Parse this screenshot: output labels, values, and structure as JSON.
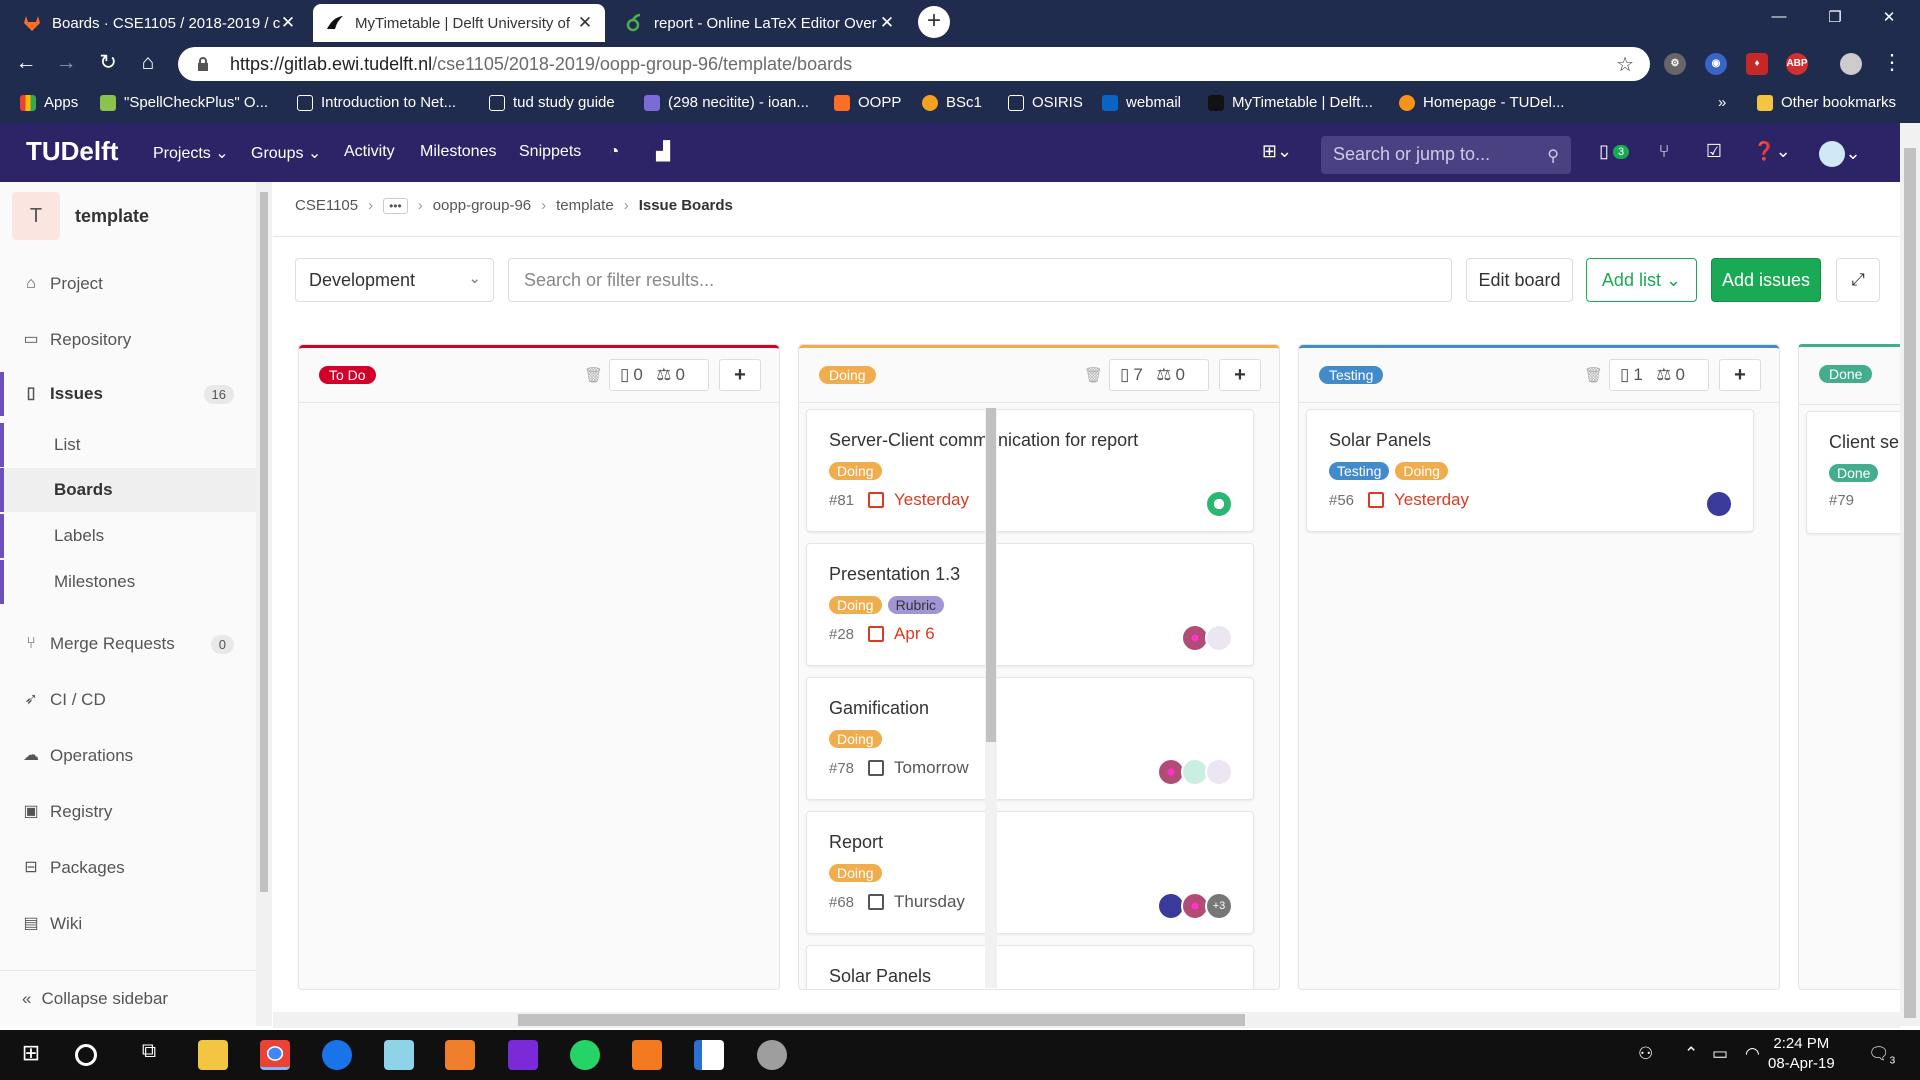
{
  "browser": {
    "tabs": [
      {
        "title": "Boards · CSE1105 / 2018-2019 / c",
        "active": false
      },
      {
        "title": "MyTimetable | Delft University of",
        "active": true
      },
      {
        "title": "report - Online LaTeX Editor Over",
        "active": false
      }
    ],
    "url_host": "https://gitlab.ewi.tudelft.nl",
    "url_path": "/cse1105/2018-2019/oopp-group-96/template/boards",
    "extensions": [
      "settings",
      "owl",
      "shield",
      "ABP"
    ],
    "bookmarks": [
      {
        "label": "Apps",
        "icon": "apps-grid-icon"
      },
      {
        "label": "\"SpellCheckPlus\" O...",
        "icon": "check-leaf-icon"
      },
      {
        "label": "Introduction to Net...",
        "icon": "page-icon"
      },
      {
        "label": "tud study guide",
        "icon": "page-icon"
      },
      {
        "label": "(298 necitite) - ioan...",
        "icon": "mail-icon"
      },
      {
        "label": "OOPP",
        "icon": "gitlab-icon"
      },
      {
        "label": "BSc1",
        "icon": "dots-icon"
      },
      {
        "label": "OSIRIS",
        "icon": "page-icon"
      },
      {
        "label": "webmail",
        "icon": "outlook-icon"
      },
      {
        "label": "MyTimetable | Delft...",
        "icon": "bird-icon"
      },
      {
        "label": "Homepage - TUDel...",
        "icon": "b-icon"
      }
    ],
    "bookmarks_overflow": "»",
    "other_bookmarks": "Other bookmarks"
  },
  "gitlab": {
    "logo": "TUDelft",
    "nav": [
      "Projects",
      "Groups",
      "Activity",
      "Milestones",
      "Snippets"
    ],
    "search_placeholder": "Search or jump to...",
    "todo_count": "3"
  },
  "sidebar": {
    "avatar_letter": "T",
    "project_name": "template",
    "items": [
      {
        "label": "Project",
        "icon": "home-icon"
      },
      {
        "label": "Repository",
        "icon": "book-icon"
      },
      {
        "label": "Issues",
        "icon": "issues-icon",
        "badge": "16"
      },
      {
        "label": "Merge Requests",
        "icon": "merge-icon",
        "badge": "0"
      },
      {
        "label": "CI / CD",
        "icon": "rocket-icon"
      },
      {
        "label": "Operations",
        "icon": "cloud-gear-icon"
      },
      {
        "label": "Registry",
        "icon": "registry-icon"
      },
      {
        "label": "Packages",
        "icon": "package-icon"
      },
      {
        "label": "Wiki",
        "icon": "wiki-icon"
      }
    ],
    "issues_sub": [
      "List",
      "Boards",
      "Labels",
      "Milestones"
    ],
    "collapse": "Collapse sidebar"
  },
  "breadcrumb": {
    "items": [
      "CSE1105",
      "oopp-group-96",
      "template"
    ],
    "current": "Issue Boards"
  },
  "board_controls": {
    "board_name": "Development",
    "filter_placeholder": "Search or filter results...",
    "edit_board": "Edit board",
    "add_list": "Add list",
    "add_issues": "Add issues"
  },
  "lists": [
    {
      "label": "To Do",
      "color": "#d1002a",
      "issues": "0",
      "weight": "0",
      "cards": []
    },
    {
      "label": "Doing",
      "color": "#f0ad4e",
      "issues": "7",
      "weight": "0",
      "cards": [
        {
          "title": "Server-Client communication for report",
          "labels": [
            {
              "text": "Doing",
              "color": "#f0ad4e"
            }
          ],
          "number": "#81",
          "due": "Yesterday",
          "due_overdue": true,
          "avatars": 1
        },
        {
          "title": "Presentation 1.3",
          "labels": [
            {
              "text": "Doing",
              "color": "#f0ad4e"
            },
            {
              "text": "Rubric",
              "color": "#a295d6"
            }
          ],
          "number": "#28",
          "due": "Apr 6",
          "due_overdue": true,
          "avatars": 2
        },
        {
          "title": "Gamification",
          "labels": [
            {
              "text": "Doing",
              "color": "#f0ad4e"
            }
          ],
          "number": "#78",
          "due": "Tomorrow",
          "due_overdue": false,
          "avatars": 3
        },
        {
          "title": "Report",
          "labels": [
            {
              "text": "Doing",
              "color": "#f0ad4e"
            }
          ],
          "number": "#68",
          "due": "Thursday",
          "due_overdue": false,
          "avatars": 2,
          "more": "+3"
        },
        {
          "title": "Solar Panels",
          "labels": [],
          "number": "",
          "due": "",
          "due_overdue": false,
          "avatars": 0
        }
      ]
    },
    {
      "label": "Testing",
      "color": "#428bca",
      "issues": "1",
      "weight": "0",
      "cards": [
        {
          "title": "Solar Panels",
          "labels": [
            {
              "text": "Testing",
              "color": "#428bca"
            },
            {
              "text": "Doing",
              "color": "#f0ad4e"
            }
          ],
          "number": "#56",
          "due": "Yesterday",
          "due_overdue": true,
          "avatars": 1
        }
      ]
    },
    {
      "label": "Done",
      "color": "#44ad8e",
      "issues": "",
      "weight": "",
      "cards": [
        {
          "title": "Client ser",
          "labels": [
            {
              "text": "Done",
              "color": "#44ad8e"
            }
          ],
          "number": "#79",
          "due": "",
          "due_overdue": false,
          "avatars": 0
        }
      ]
    }
  ],
  "taskbar": {
    "time": "2:24 PM",
    "date": "08-Apr-19",
    "notifications": "3"
  }
}
